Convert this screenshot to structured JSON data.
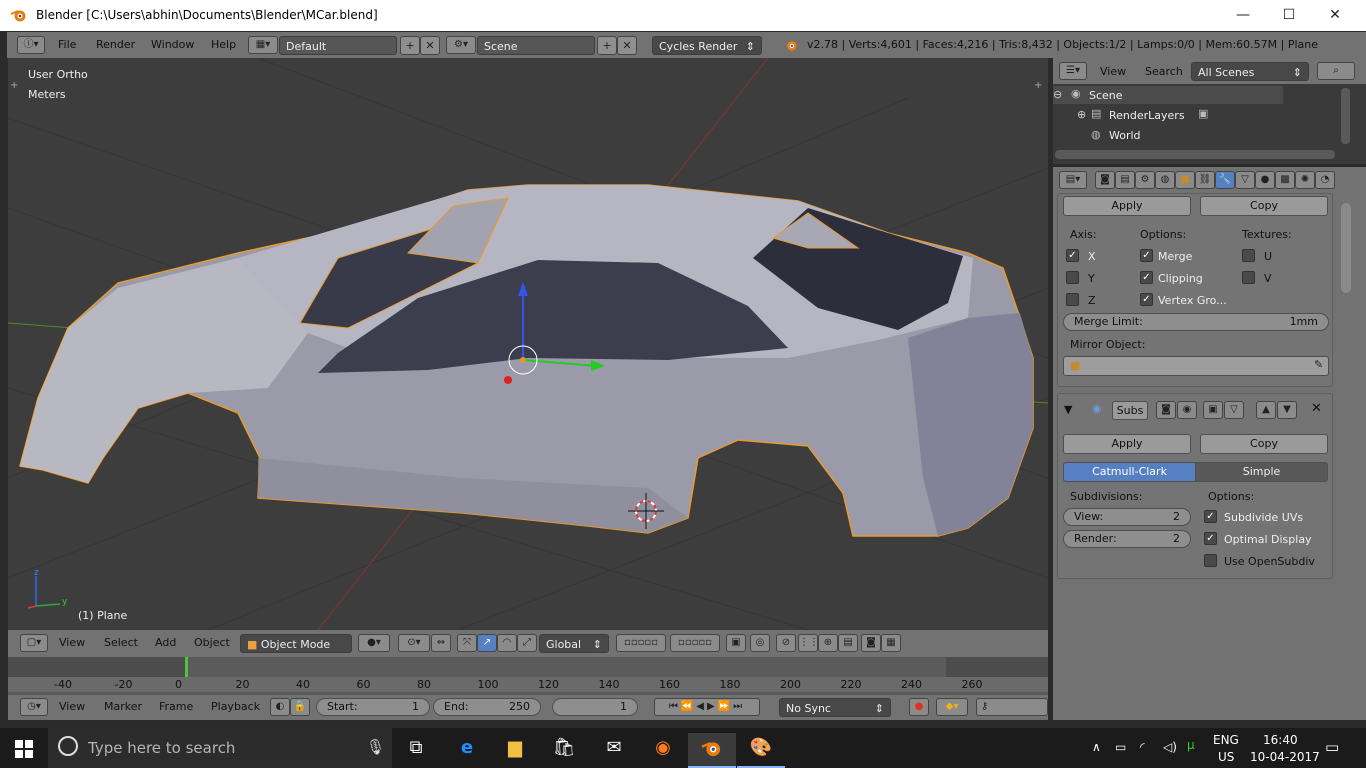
{
  "window": {
    "title": "Blender [C:\\Users\\abhin\\Documents\\Blender\\MCar.blend]",
    "min": "—",
    "max": "☐",
    "close": "✕"
  },
  "info": {
    "menus": [
      "File",
      "Render",
      "Window",
      "Help"
    ],
    "layout": "Default",
    "scene": "Scene",
    "engine": "Cycles Render",
    "stats": "v2.78 | Verts:4,601 | Faces:4,216 | Tris:8,432 | Objects:1/2 | Lamps:0/0 | Mem:60.57M | Plane"
  },
  "viewport": {
    "view_name": "User Ortho",
    "units": "Meters",
    "object_label": "(1) Plane"
  },
  "vp_header": {
    "menus": [
      "View",
      "Select",
      "Add",
      "Object"
    ],
    "mode": "Object Mode",
    "orientation": "Global"
  },
  "timeline": {
    "ticks": [
      "-40",
      "-20",
      "0",
      "20",
      "40",
      "60",
      "80",
      "100",
      "120",
      "140",
      "160",
      "180",
      "200",
      "220",
      "240",
      "260"
    ],
    "current_frame": 0,
    "menus": [
      "View",
      "Marker",
      "Frame",
      "Playback"
    ],
    "start_label": "Start:",
    "start": "1",
    "end_label": "End:",
    "end": "250",
    "frame": "1",
    "sync": "No Sync"
  },
  "outliner": {
    "menus": [
      "View",
      "Search"
    ],
    "filter": "All Scenes",
    "items": [
      "Scene",
      "RenderLayers",
      "World"
    ]
  },
  "mirror": {
    "apply": "Apply",
    "copy": "Copy",
    "axis_label": "Axis:",
    "options_label": "Options:",
    "textures_label": "Textures:",
    "x": "X",
    "y": "Y",
    "z": "Z",
    "merge": "Merge",
    "clipping": "Clipping",
    "vertex_groups": "Vertex Gro...",
    "u": "U",
    "v": "V",
    "merge_limit_label": "Merge Limit:",
    "merge_limit": "1mm",
    "mirror_object_label": "Mirror Object:"
  },
  "subsurf": {
    "name": "Subs",
    "apply": "Apply",
    "copy": "Copy",
    "catmull": "Catmull-Clark",
    "simple": "Simple",
    "subdivisions_label": "Subdivisions:",
    "options_label": "Options:",
    "view_label": "View:",
    "view": "2",
    "render_label": "Render:",
    "render": "2",
    "subdivide_uvs": "Subdivide UVs",
    "optimal_display": "Optimal Display",
    "use_opensubdiv": "Use OpenSubdiv"
  },
  "taskbar": {
    "search_placeholder": "Type here to search",
    "lang": "ENG",
    "region": "US",
    "time": "16:40",
    "date": "10-04-2017"
  },
  "colors": {
    "accent": "#5680c2",
    "selected_outline": "#f0a030",
    "viewport_bg": "#3d3d3d"
  }
}
